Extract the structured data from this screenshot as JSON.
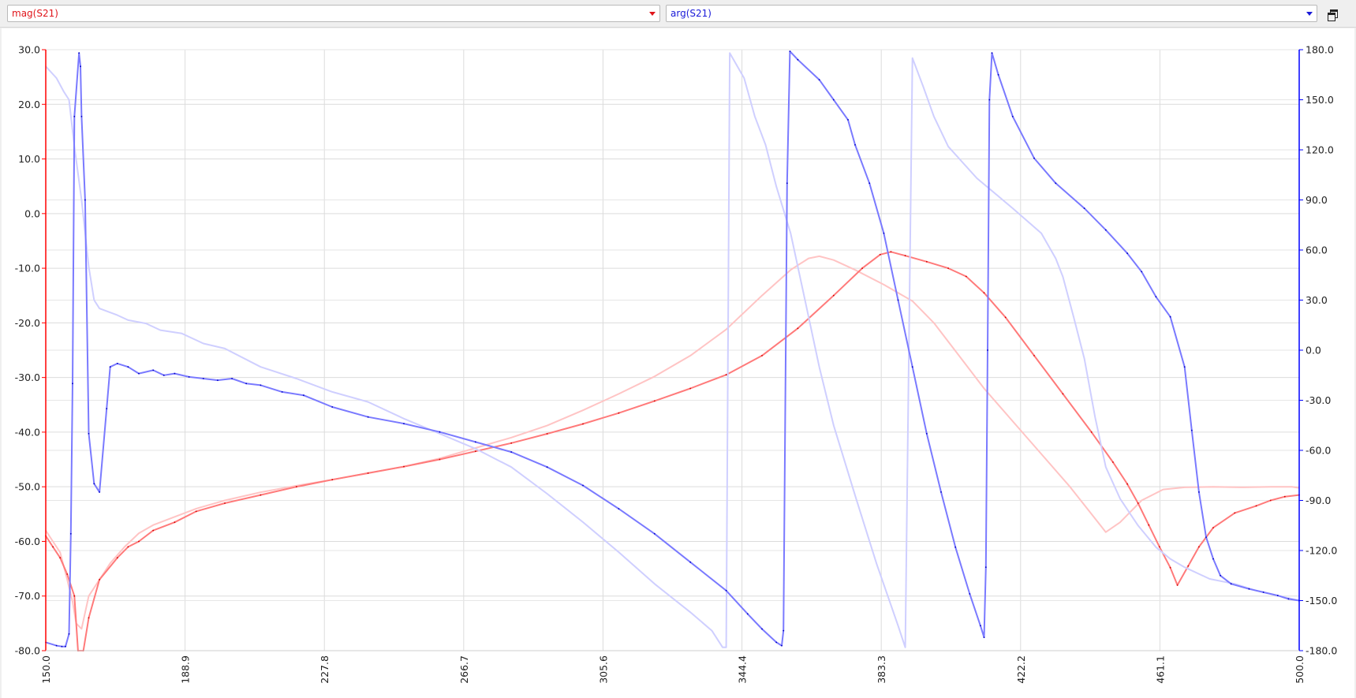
{
  "toolbar": {
    "left_trace_label": "mag(S21)",
    "right_trace_label": "arg(S21)"
  },
  "colors": {
    "mag": "#ff0000",
    "arg": "#0000ff",
    "grid": "#dcdcdc"
  },
  "chart_data": {
    "type": "line",
    "title": "",
    "grid": true,
    "x_axis": {
      "min": 150.0,
      "max": 500.0,
      "ticks": [
        "150.0",
        "188.9",
        "227.8",
        "266.7",
        "305.6",
        "344.4",
        "383.3",
        "422.2",
        "461.1",
        "500.0"
      ]
    },
    "y_left": {
      "min": -80.0,
      "max": 30.0,
      "ticks": [
        "30.0",
        "20.0",
        "10.0",
        "0.0",
        "-10.0",
        "-20.0",
        "-30.0",
        "-40.0",
        "-50.0",
        "-60.0",
        "-70.0",
        "-80.0"
      ]
    },
    "y_right": {
      "min": -180.0,
      "max": 180.0,
      "ticks": [
        "180.0",
        "150.0",
        "120.0",
        "90.0",
        "60.0",
        "30.0",
        "0.0",
        "-30.0",
        "-60.0",
        "-90.0",
        "-120.0",
        "-150.0",
        "-180.0"
      ]
    },
    "series": [
      {
        "name": "mag(S21)",
        "axis": "left",
        "role": "faded",
        "points": [
          [
            150.0,
            -58
          ],
          [
            152,
            -60
          ],
          [
            154,
            -62
          ],
          [
            156,
            -67
          ],
          [
            157.5,
            -71
          ],
          [
            158.5,
            -75
          ],
          [
            160,
            -76
          ],
          [
            162,
            -70
          ],
          [
            165,
            -67
          ],
          [
            168,
            -64
          ],
          [
            172,
            -61
          ],
          [
            176,
            -58.5
          ],
          [
            180,
            -57
          ],
          [
            186,
            -55.5
          ],
          [
            192,
            -54
          ],
          [
            200,
            -52.5
          ],
          [
            210,
            -51
          ],
          [
            220,
            -49.8
          ],
          [
            230,
            -48.7
          ],
          [
            240,
            -47.5
          ],
          [
            250,
            -46.3
          ],
          [
            260,
            -44.8
          ],
          [
            270,
            -42.9
          ],
          [
            280,
            -41
          ],
          [
            290,
            -38.8
          ],
          [
            300,
            -36
          ],
          [
            310,
            -33
          ],
          [
            320,
            -29.8
          ],
          [
            330,
            -26
          ],
          [
            340,
            -21.2
          ],
          [
            350,
            -15
          ],
          [
            358,
            -10.3
          ],
          [
            363,
            -8.2
          ],
          [
            366,
            -7.8
          ],
          [
            370,
            -8.5
          ],
          [
            376,
            -10.3
          ],
          [
            384,
            -13
          ],
          [
            392,
            -16
          ],
          [
            398,
            -20
          ],
          [
            405,
            -26
          ],
          [
            412,
            -32
          ],
          [
            420,
            -38
          ],
          [
            428,
            -44
          ],
          [
            436,
            -50
          ],
          [
            442,
            -55
          ],
          [
            446,
            -58.3
          ],
          [
            450,
            -56.5
          ],
          [
            456,
            -52.5
          ],
          [
            462,
            -50.5
          ],
          [
            468,
            -50.1
          ],
          [
            476,
            -50.0
          ],
          [
            484,
            -50.1
          ],
          [
            492,
            -50.0
          ],
          [
            498,
            -50.0
          ],
          [
            500,
            -50.2
          ]
        ]
      },
      {
        "name": "mag(S21)",
        "axis": "left",
        "role": "active",
        "points": [
          [
            150.0,
            -59
          ],
          [
            152,
            -61
          ],
          [
            154,
            -63
          ],
          [
            156,
            -66
          ],
          [
            158,
            -70
          ],
          [
            159,
            -80
          ],
          [
            160.5,
            -80
          ],
          [
            162,
            -74
          ],
          [
            165,
            -67
          ],
          [
            170,
            -63
          ],
          [
            173,
            -61
          ],
          [
            176,
            -60
          ],
          [
            180,
            -58
          ],
          [
            186,
            -56.5
          ],
          [
            192,
            -54.5
          ],
          [
            200,
            -53
          ],
          [
            210,
            -51.5
          ],
          [
            220,
            -50
          ],
          [
            230,
            -48.7
          ],
          [
            240,
            -47.5
          ],
          [
            250,
            -46.3
          ],
          [
            260,
            -45
          ],
          [
            270,
            -43.5
          ],
          [
            280,
            -42
          ],
          [
            290,
            -40.3
          ],
          [
            300,
            -38.5
          ],
          [
            310,
            -36.5
          ],
          [
            320,
            -34.3
          ],
          [
            330,
            -32
          ],
          [
            340,
            -29.5
          ],
          [
            350,
            -26
          ],
          [
            360,
            -21
          ],
          [
            370,
            -15
          ],
          [
            378,
            -10
          ],
          [
            383,
            -7.5
          ],
          [
            386,
            -7.0
          ],
          [
            390,
            -7.7
          ],
          [
            396,
            -8.8
          ],
          [
            402,
            -10
          ],
          [
            407,
            -11.5
          ],
          [
            412,
            -14.5
          ],
          [
            418,
            -19
          ],
          [
            426,
            -26
          ],
          [
            434,
            -33
          ],
          [
            442,
            -40
          ],
          [
            448,
            -45.5
          ],
          [
            452,
            -49.5
          ],
          [
            455,
            -53
          ],
          [
            458,
            -57
          ],
          [
            461,
            -61
          ],
          [
            464,
            -64.8
          ],
          [
            466,
            -68
          ],
          [
            469,
            -64.5
          ],
          [
            472,
            -61
          ],
          [
            476,
            -57.5
          ],
          [
            482,
            -54.8
          ],
          [
            488,
            -53.5
          ],
          [
            492,
            -52.5
          ],
          [
            496,
            -51.8
          ],
          [
            500,
            -51.5
          ]
        ]
      },
      {
        "name": "arg(S21)",
        "axis": "right",
        "role": "faded",
        "points": [
          [
            150.0,
            170
          ],
          [
            153,
            163
          ],
          [
            155,
            155
          ],
          [
            156.5,
            150
          ],
          [
            158,
            122
          ],
          [
            160,
            90
          ],
          [
            162,
            50
          ],
          [
            163.5,
            30
          ],
          [
            165,
            25
          ],
          [
            170,
            21
          ],
          [
            173,
            18
          ],
          [
            178,
            16
          ],
          [
            182,
            12
          ],
          [
            188,
            10
          ],
          [
            194,
            4
          ],
          [
            200,
            1
          ],
          [
            210,
            -10
          ],
          [
            220,
            -17
          ],
          [
            230,
            -25
          ],
          [
            240,
            -31
          ],
          [
            250,
            -41
          ],
          [
            260,
            -50
          ],
          [
            270,
            -59
          ],
          [
            280,
            -70
          ],
          [
            290,
            -86
          ],
          [
            300,
            -103
          ],
          [
            310,
            -121
          ],
          [
            320,
            -140
          ],
          [
            330,
            -157
          ],
          [
            336,
            -168
          ],
          [
            339,
            -178
          ],
          [
            340,
            -178
          ],
          [
            341,
            178
          ],
          [
            345,
            163
          ],
          [
            348,
            140
          ],
          [
            351,
            123
          ],
          [
            354,
            98
          ],
          [
            358,
            70
          ],
          [
            362,
            30
          ],
          [
            366,
            -10
          ],
          [
            370,
            -45
          ],
          [
            376,
            -87
          ],
          [
            382,
            -128
          ],
          [
            388,
            -165
          ],
          [
            390,
            -178
          ],
          [
            392,
            175
          ],
          [
            395,
            158
          ],
          [
            398,
            140
          ],
          [
            402,
            122
          ],
          [
            410,
            103
          ],
          [
            420,
            85
          ],
          [
            428,
            70
          ],
          [
            432,
            55
          ],
          [
            434,
            44
          ],
          [
            437,
            20
          ],
          [
            440,
            -5
          ],
          [
            443,
            -40
          ],
          [
            446,
            -70
          ],
          [
            450,
            -89
          ],
          [
            455,
            -105
          ],
          [
            460,
            -118
          ],
          [
            464,
            -125
          ],
          [
            468,
            -130
          ],
          [
            475,
            -137
          ],
          [
            482,
            -140
          ],
          [
            488,
            -144
          ],
          [
            494,
            -147
          ],
          [
            500,
            -150
          ]
        ]
      },
      {
        "name": "arg(S21)",
        "axis": "right",
        "role": "active",
        "points": [
          [
            150.0,
            -175
          ],
          [
            153,
            -177
          ],
          [
            154.5,
            -177.5
          ],
          [
            155.5,
            -177.5
          ],
          [
            156.5,
            -170
          ],
          [
            157,
            -110
          ],
          [
            157.5,
            -20
          ],
          [
            158,
            140
          ],
          [
            159.3,
            178
          ],
          [
            159.7,
            170
          ],
          [
            160,
            140
          ],
          [
            161,
            90
          ],
          [
            162,
            -50
          ],
          [
            163.5,
            -80
          ],
          [
            165,
            -85
          ],
          [
            167,
            -35
          ],
          [
            168,
            -10
          ],
          [
            170,
            -8
          ],
          [
            173,
            -10
          ],
          [
            176,
            -14
          ],
          [
            180,
            -12
          ],
          [
            183,
            -15
          ],
          [
            186,
            -14
          ],
          [
            190,
            -16
          ],
          [
            194,
            -17
          ],
          [
            198,
            -18
          ],
          [
            202,
            -17
          ],
          [
            206,
            -20
          ],
          [
            210,
            -21
          ],
          [
            216,
            -25
          ],
          [
            222,
            -27
          ],
          [
            230,
            -34
          ],
          [
            240,
            -40
          ],
          [
            250,
            -44
          ],
          [
            260,
            -49
          ],
          [
            270,
            -55
          ],
          [
            280,
            -61
          ],
          [
            290,
            -70
          ],
          [
            300,
            -81
          ],
          [
            310,
            -95
          ],
          [
            320,
            -110
          ],
          [
            330,
            -127
          ],
          [
            340,
            -144
          ],
          [
            346,
            -158
          ],
          [
            350,
            -167
          ],
          [
            354,
            -175
          ],
          [
            355.5,
            -177
          ],
          [
            356,
            -168
          ],
          [
            357,
            100
          ],
          [
            357.8,
            179
          ],
          [
            360,
            174
          ],
          [
            366,
            162
          ],
          [
            370,
            150
          ],
          [
            374,
            138
          ],
          [
            376,
            123
          ],
          [
            380,
            100
          ],
          [
            384,
            70
          ],
          [
            388,
            30
          ],
          [
            392,
            -10
          ],
          [
            396,
            -50
          ],
          [
            400,
            -85
          ],
          [
            404,
            -118
          ],
          [
            408,
            -146
          ],
          [
            411,
            -165
          ],
          [
            412,
            -172
          ],
          [
            412.5,
            -130
          ],
          [
            413,
            0
          ],
          [
            413.5,
            150
          ],
          [
            414.2,
            178
          ],
          [
            416,
            165
          ],
          [
            420,
            140
          ],
          [
            426,
            115
          ],
          [
            432,
            100
          ],
          [
            440,
            85
          ],
          [
            446,
            72
          ],
          [
            452,
            58
          ],
          [
            456,
            47
          ],
          [
            460,
            32
          ],
          [
            464,
            20
          ],
          [
            468,
            -10
          ],
          [
            470,
            -48
          ],
          [
            472,
            -85
          ],
          [
            474,
            -112
          ],
          [
            476,
            -125
          ],
          [
            478,
            -135
          ],
          [
            481,
            -140
          ],
          [
            486,
            -143
          ],
          [
            490,
            -145
          ],
          [
            494,
            -147
          ],
          [
            497,
            -149
          ],
          [
            500,
            -150
          ]
        ]
      }
    ]
  }
}
